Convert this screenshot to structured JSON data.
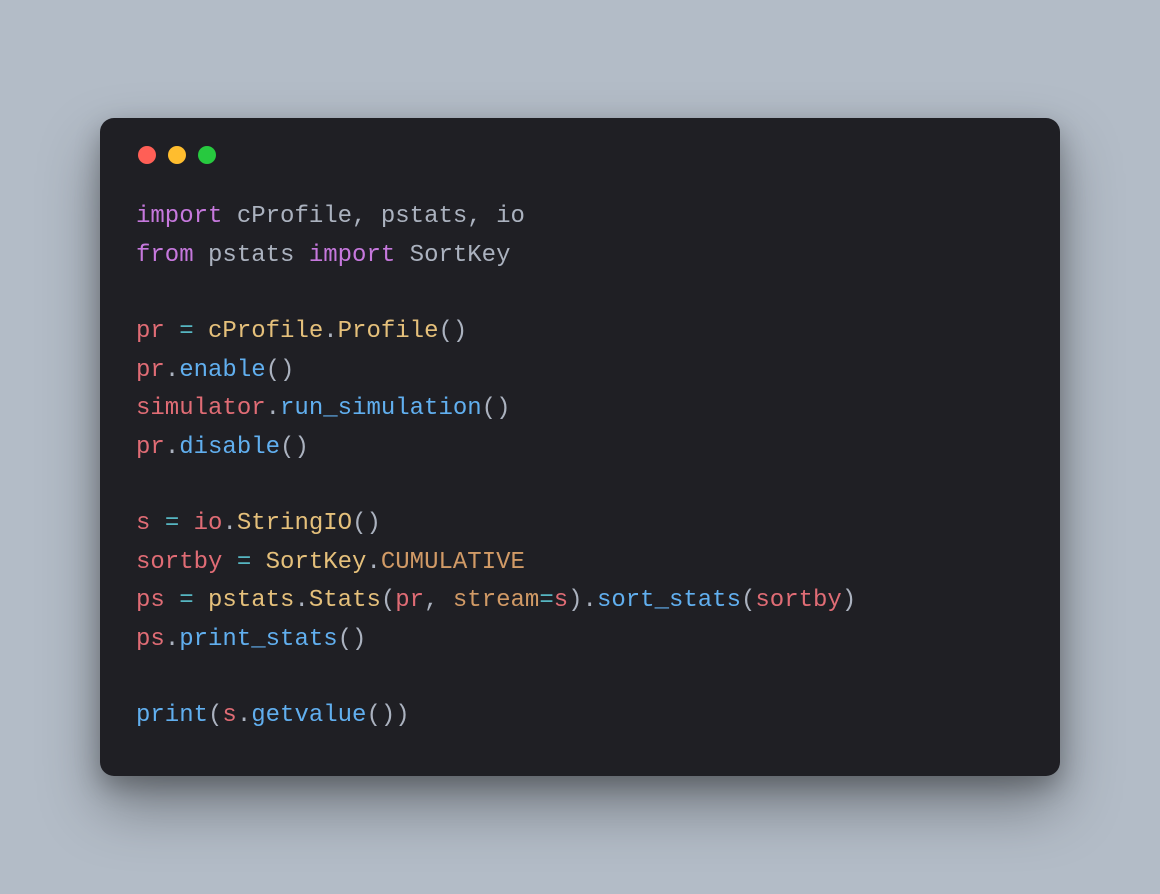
{
  "traffic_lights": [
    "red",
    "yellow",
    "green"
  ],
  "code": {
    "lines": [
      {
        "tokens": [
          {
            "t": "import ",
            "c": "kw"
          },
          {
            "t": "cProfile",
            "c": "name"
          },
          {
            "t": ", ",
            "c": "pun"
          },
          {
            "t": "pstats",
            "c": "name"
          },
          {
            "t": ", ",
            "c": "pun"
          },
          {
            "t": "io",
            "c": "name"
          }
        ]
      },
      {
        "tokens": [
          {
            "t": "from ",
            "c": "kw"
          },
          {
            "t": "pstats ",
            "c": "name"
          },
          {
            "t": "import ",
            "c": "kw"
          },
          {
            "t": "SortKey",
            "c": "name"
          }
        ]
      },
      {
        "tokens": [
          {
            "t": "",
            "c": "pun"
          }
        ]
      },
      {
        "tokens": [
          {
            "t": "pr ",
            "c": "var"
          },
          {
            "t": "= ",
            "c": "op"
          },
          {
            "t": "cProfile",
            "c": "cls"
          },
          {
            "t": ".",
            "c": "pun"
          },
          {
            "t": "Profile",
            "c": "cls"
          },
          {
            "t": "()",
            "c": "pun"
          }
        ]
      },
      {
        "tokens": [
          {
            "t": "pr",
            "c": "var"
          },
          {
            "t": ".",
            "c": "pun"
          },
          {
            "t": "enable",
            "c": "func"
          },
          {
            "t": "()",
            "c": "pun"
          }
        ]
      },
      {
        "tokens": [
          {
            "t": "simulator",
            "c": "var"
          },
          {
            "t": ".",
            "c": "pun"
          },
          {
            "t": "run_simulation",
            "c": "func"
          },
          {
            "t": "()",
            "c": "pun"
          }
        ]
      },
      {
        "tokens": [
          {
            "t": "pr",
            "c": "var"
          },
          {
            "t": ".",
            "c": "pun"
          },
          {
            "t": "disable",
            "c": "func"
          },
          {
            "t": "()",
            "c": "pun"
          }
        ]
      },
      {
        "tokens": [
          {
            "t": "",
            "c": "pun"
          }
        ]
      },
      {
        "tokens": [
          {
            "t": "s ",
            "c": "var"
          },
          {
            "t": "= ",
            "c": "op"
          },
          {
            "t": "io",
            "c": "var"
          },
          {
            "t": ".",
            "c": "pun"
          },
          {
            "t": "StringIO",
            "c": "cls"
          },
          {
            "t": "()",
            "c": "pun"
          }
        ]
      },
      {
        "tokens": [
          {
            "t": "sortby ",
            "c": "var"
          },
          {
            "t": "= ",
            "c": "op"
          },
          {
            "t": "SortKey",
            "c": "cls"
          },
          {
            "t": ".",
            "c": "pun"
          },
          {
            "t": "CUMULATIVE",
            "c": "attr"
          }
        ]
      },
      {
        "tokens": [
          {
            "t": "ps ",
            "c": "var"
          },
          {
            "t": "= ",
            "c": "op"
          },
          {
            "t": "pstats",
            "c": "cls"
          },
          {
            "t": ".",
            "c": "pun"
          },
          {
            "t": "Stats",
            "c": "cls"
          },
          {
            "t": "(",
            "c": "pun"
          },
          {
            "t": "pr",
            "c": "var"
          },
          {
            "t": ", ",
            "c": "pun"
          },
          {
            "t": "stream",
            "c": "attr"
          },
          {
            "t": "=",
            "c": "op"
          },
          {
            "t": "s",
            "c": "var"
          },
          {
            "t": ").",
            "c": "pun"
          },
          {
            "t": "sort_stats",
            "c": "func"
          },
          {
            "t": "(",
            "c": "pun"
          },
          {
            "t": "sortby",
            "c": "var"
          },
          {
            "t": ")",
            "c": "pun"
          }
        ]
      },
      {
        "tokens": [
          {
            "t": "ps",
            "c": "var"
          },
          {
            "t": ".",
            "c": "pun"
          },
          {
            "t": "print_stats",
            "c": "func"
          },
          {
            "t": "()",
            "c": "pun"
          }
        ]
      },
      {
        "tokens": [
          {
            "t": "",
            "c": "pun"
          }
        ]
      },
      {
        "tokens": [
          {
            "t": "print",
            "c": "func"
          },
          {
            "t": "(",
            "c": "pun"
          },
          {
            "t": "s",
            "c": "var"
          },
          {
            "t": ".",
            "c": "pun"
          },
          {
            "t": "getvalue",
            "c": "func"
          },
          {
            "t": "())",
            "c": "pun"
          }
        ]
      }
    ]
  }
}
